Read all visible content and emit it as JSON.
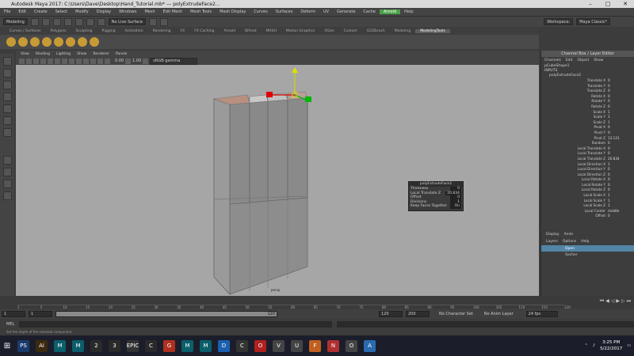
{
  "window": {
    "title": "Autodesk Maya 2017: C:\\Users\\Dave\\Desktop\\Hand_Tutorial.mb*  ---  polyExtrudeFace2...",
    "minimize": "–",
    "maximize": "□",
    "close": "✕"
  },
  "menubar": {
    "items": [
      "File",
      "Edit",
      "Create",
      "Select",
      "Modify",
      "Display",
      "Windows",
      "Mesh",
      "Edit Mesh",
      "Mesh Tools",
      "Mesh Display",
      "Curves",
      "Surfaces",
      "Deform",
      "UV",
      "Generate",
      "Cache",
      "Arnold",
      "Help"
    ],
    "highlight_index": 17,
    "workspace_label": "Workspace:",
    "workspace_value": "Maya Classic*"
  },
  "statusline": {
    "mode": "Modeling",
    "symmetry": "No Live Surface",
    "signin": "Sign in"
  },
  "shelf": {
    "tabs": [
      "Curves / Surfaces",
      "Polygons",
      "Sculpting",
      "Rigging",
      "Animation",
      "Rendering",
      "FX",
      "FX Caching",
      "Arnold",
      "Bifrost",
      "MASH",
      "Motion Graphics",
      "XGen",
      "Custom",
      "GOZbrush",
      "Modeling",
      "ModelingTools"
    ],
    "active_index": 16,
    "icon_count": 8
  },
  "panel": {
    "menus": [
      "View",
      "Shading",
      "Lighting",
      "Show",
      "Renderer",
      "Panels"
    ],
    "value1": "0.00",
    "value2": "1.00",
    "colorspace": "sRGB gamma"
  },
  "viewport": {
    "object_label": "persp",
    "background": "#a6a6a6"
  },
  "tooltip": {
    "title": "polyExtrudeFace2",
    "rows": [
      {
        "label": "Thickness",
        "value": "0"
      },
      {
        "label": "Local Translate Z",
        "value": "20.834"
      },
      {
        "label": "Offset",
        "value": "0"
      },
      {
        "label": "Divisions",
        "value": "1"
      },
      {
        "label": "Keep Faces Together",
        "value": "On"
      }
    ]
  },
  "channelbox": {
    "header": "Channel Box / Layer Editor",
    "tabs": [
      "Channels",
      "Edit",
      "Object",
      "Show"
    ],
    "objects": [
      "pCubeShape1",
      "INPUTS",
      "polyExtrudeFace2"
    ],
    "attributes": [
      {
        "name": "Translate X",
        "value": "0"
      },
      {
        "name": "Translate Y",
        "value": "0"
      },
      {
        "name": "Translate Z",
        "value": "0"
      },
      {
        "name": "Rotate X",
        "value": "0"
      },
      {
        "name": "Rotate Y",
        "value": "0"
      },
      {
        "name": "Rotate Z",
        "value": "0"
      },
      {
        "name": "Scale X",
        "value": "1"
      },
      {
        "name": "Scale Y",
        "value": "1"
      },
      {
        "name": "Scale Z",
        "value": "1"
      },
      {
        "name": "Pivot X",
        "value": "0"
      },
      {
        "name": "Pivot Y",
        "value": "0"
      },
      {
        "name": "Pivot Z",
        "value": "13.121"
      },
      {
        "name": "Random",
        "value": "0"
      },
      {
        "name": "Local Translate X",
        "value": "0"
      },
      {
        "name": "Local Translate Y",
        "value": "0"
      },
      {
        "name": "Local Translate Z",
        "value": "20.834"
      },
      {
        "name": "Local Direction X",
        "value": "1"
      },
      {
        "name": "Local Direction Y",
        "value": "0"
      },
      {
        "name": "Local Direction Z",
        "value": "0"
      },
      {
        "name": "Local Rotate X",
        "value": "0"
      },
      {
        "name": "Local Rotate Y",
        "value": "0"
      },
      {
        "name": "Local Rotate Z",
        "value": "0"
      },
      {
        "name": "Local Scale X",
        "value": "1"
      },
      {
        "name": "Local Scale Y",
        "value": "1"
      },
      {
        "name": "Local Scale Z",
        "value": "1"
      },
      {
        "name": "Local Center",
        "value": "middle"
      },
      {
        "name": "Offset",
        "value": "0"
      }
    ]
  },
  "layers": {
    "tabs": [
      "Display",
      "Anim"
    ],
    "menus": [
      "Layers",
      "Options",
      "Help"
    ],
    "items": [
      "Open",
      "Socher"
    ]
  },
  "timeline": {
    "ticks": [
      "1",
      "5",
      "10",
      "15",
      "20",
      "25",
      "30",
      "35",
      "40",
      "45",
      "50",
      "55",
      "60",
      "65",
      "70",
      "75",
      "80",
      "85",
      "90",
      "95",
      "100",
      "105",
      "110",
      "115",
      "120"
    ],
    "current": "1"
  },
  "range": {
    "start": "1",
    "inner_start": "1",
    "inner_end": "120",
    "end": "120",
    "max": "200",
    "char_set": "No Character Set",
    "anim_layer": "No Anim Layer",
    "fps": "24 fps"
  },
  "mel": {
    "label": "MEL"
  },
  "help": {
    "text": "Set the depth of the selected component"
  },
  "taskbar": {
    "apps": [
      "PS",
      "Ai",
      "M",
      "M",
      "2",
      "3",
      "EPIC",
      "C",
      "G",
      "M",
      "M",
      "D",
      "C",
      "O",
      "V",
      "U",
      "F",
      "N",
      "O",
      "A"
    ],
    "time": "3:25 PM",
    "date": "5/22/2017"
  }
}
